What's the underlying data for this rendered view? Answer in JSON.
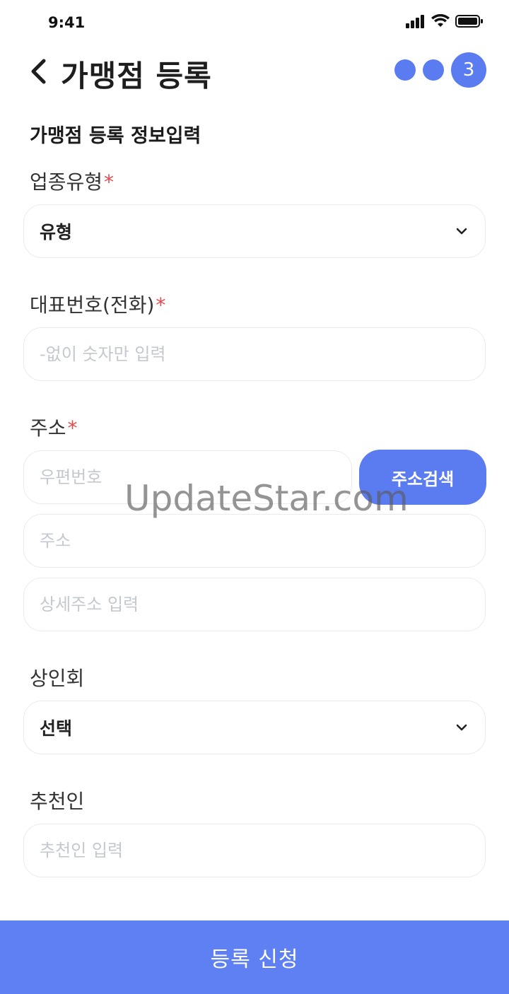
{
  "status": {
    "time": "9:41"
  },
  "header": {
    "title": "가맹점 등록",
    "step_current": "3"
  },
  "section_title": "가맹점 등록 정보입력",
  "business_type": {
    "label": "업종유형",
    "required": "*",
    "value": "유형"
  },
  "phone": {
    "label": "대표번호(전화)",
    "required": "*",
    "placeholder": "-없이 숫자만 입력"
  },
  "address": {
    "label": "주소",
    "required": "*",
    "zip_placeholder": "우편번호",
    "search_label": "주소검색",
    "address_placeholder": "주소",
    "detail_placeholder": "상세주소 입력"
  },
  "merchant_assoc": {
    "label": "상인회",
    "value": "선택"
  },
  "recommender": {
    "label": "추천인",
    "placeholder": "추천인 입력"
  },
  "submit_label": "등록 신청",
  "watermark": "UpdateStar.com",
  "colors": {
    "accent": "#5b7cf0",
    "required": "#e5484d",
    "border": "#e8ecf2"
  }
}
